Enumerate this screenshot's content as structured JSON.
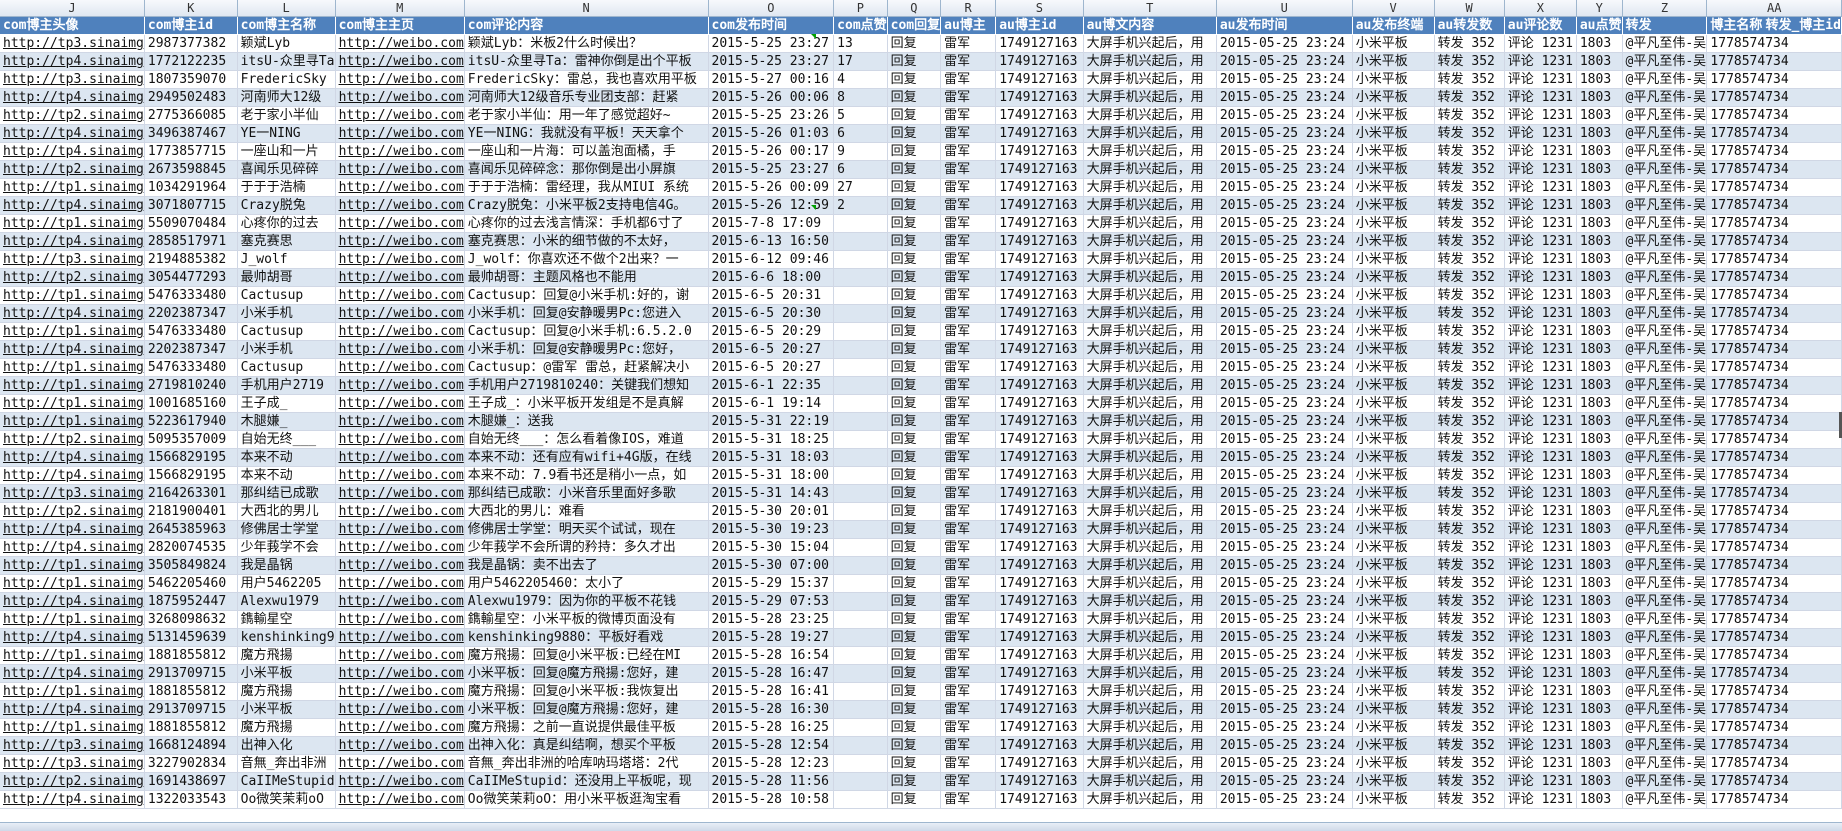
{
  "sheet": {
    "columns": [
      "J",
      "K",
      "L",
      "M",
      "N",
      "O",
      "P",
      "Q",
      "R",
      "S",
      "T",
      "U",
      "V",
      "W",
      "X",
      "Y",
      "Z",
      "AA"
    ],
    "headers": [
      "com博主头像",
      "com博主id",
      "com博主名称",
      "com博主主页",
      "com评论内容",
      "com发布时间",
      "com点赞",
      "com回复",
      "au博主",
      "au博主id",
      "au博文内容",
      "au发布时间",
      "au发布终端",
      "au转发数",
      "au评论数",
      "au点赞",
      "转发",
      "博主名称",
      "转发_博主id"
    ],
    "rows": [
      [
        "http://tp3.sinaimg",
        "2987377382",
        "颖斌Lyb",
        "http://weibo.com",
        "颖斌Lyb：米板2什么时候出？",
        "2015-5-25 23:27",
        "13",
        "回复",
        "雷军",
        "1749127163",
        "大屏手机兴起后，用",
        "2015-05-25 23:24",
        "小米平板",
        "转发 352",
        "评论 1231",
        "1803",
        "@平凡至伟-吴",
        "1778574734"
      ],
      [
        "http://tp4.sinaimg",
        "1772122235",
        "itsU-众里寻Ta",
        "http://weibo.com",
        "itsU-众里寻Ta：雷神你倒是出个平板",
        "2015-5-25 23:27",
        "17",
        "回复",
        "雷军",
        "1749127163",
        "大屏手机兴起后，用",
        "2015-05-25 23:24",
        "小米平板",
        "转发 352",
        "评论 1231",
        "1803",
        "@平凡至伟-吴",
        "1778574734"
      ],
      [
        "http://tp3.sinaimg",
        "1807359070",
        "FredericSky",
        "http://weibo.com",
        "FredericSky：雷总，我也喜欢用平板",
        "2015-5-27 00:16",
        "4",
        "回复",
        "雷军",
        "1749127163",
        "大屏手机兴起后，用",
        "2015-05-25 23:24",
        "小米平板",
        "转发 352",
        "评论 1231",
        "1803",
        "@平凡至伟-吴",
        "1778574734"
      ],
      [
        "http://tp4.sinaimg",
        "2949502483",
        "河南师大12级",
        "http://weibo.com",
        "河南师大12级音乐专业团支部：赶紧",
        "2015-5-26 00:06",
        "8",
        "回复",
        "雷军",
        "1749127163",
        "大屏手机兴起后，用",
        "2015-05-25 23:24",
        "小米平板",
        "转发 352",
        "评论 1231",
        "1803",
        "@平凡至伟-吴",
        "1778574734"
      ],
      [
        "http://tp2.sinaimg",
        "2775366085",
        "老于家小半仙",
        "http://weibo.com",
        "老于家小半仙：用一年了感觉超好~",
        "2015-5-25 23:26",
        "5",
        "回复",
        "雷军",
        "1749127163",
        "大屏手机兴起后，用",
        "2015-05-25 23:24",
        "小米平板",
        "转发 352",
        "评论 1231",
        "1803",
        "@平凡至伟-吴",
        "1778574734"
      ],
      [
        "http://tp4.sinaimg",
        "3496387467",
        "YE一NING",
        "http://weibo.com",
        "YE一NING：我就没有平板！天天拿个",
        "2015-5-26 01:03",
        "6",
        "回复",
        "雷军",
        "1749127163",
        "大屏手机兴起后，用",
        "2015-05-25 23:24",
        "小米平板",
        "转发 352",
        "评论 1231",
        "1803",
        "@平凡至伟-吴",
        "1778574734"
      ],
      [
        "http://tp4.sinaimg",
        "1773857715",
        "一座山和一片",
        "http://weibo.com",
        "一座山和一片海：可以盖泡面橘，手",
        "2015-5-26 00:17",
        "9",
        "回复",
        "雷军",
        "1749127163",
        "大屏手机兴起后，用",
        "2015-05-25 23:24",
        "小米平板",
        "转发 352",
        "评论 1231",
        "1803",
        "@平凡至伟-吴",
        "1778574734"
      ],
      [
        "http://tp2.sinaimg",
        "2673598845",
        "喜闻乐见碎碎",
        "http://weibo.com",
        "喜闻乐见碎碎念：那你倒是出小屏旗",
        "2015-5-25 23:27",
        "6",
        "回复",
        "雷军",
        "1749127163",
        "大屏手机兴起后，用",
        "2015-05-25 23:24",
        "小米平板",
        "转发 352",
        "评论 1231",
        "1803",
        "@平凡至伟-吴",
        "1778574734"
      ],
      [
        "http://tp1.sinaimg",
        "1034291964",
        "于于于浩楠",
        "http://weibo.com",
        "于于于浩楠：雷经理，我从MIUI 系统",
        "2015-5-26 00:09",
        "27",
        "回复",
        "雷军",
        "1749127163",
        "大屏手机兴起后，用",
        "2015-05-25 23:24",
        "小米平板",
        "转发 352",
        "评论 1231",
        "1803",
        "@平凡至伟-吴",
        "1778574734"
      ],
      [
        "http://tp4.sinaimg",
        "3071807715",
        "Crazy脱兔",
        "http://weibo.com",
        "Crazy脱兔：小米平板2支持电信4G。",
        "2015-5-26 12:59",
        "2",
        "回复",
        "雷军",
        "1749127163",
        "大屏手机兴起后，用",
        "2015-05-25 23:24",
        "小米平板",
        "转发 352",
        "评论 1231",
        "1803",
        "@平凡至伟-吴",
        "1778574734"
      ],
      [
        "http://tp1.sinaimg",
        "5509070484",
        "心疼你的过去",
        "http://weibo.com",
        "心疼你的过去浅言情深：手机都6寸了",
        "2015-7-8 17:09",
        "",
        "回复",
        "雷军",
        "1749127163",
        "大屏手机兴起后，用",
        "2015-05-25 23:24",
        "小米平板",
        "转发 352",
        "评论 1231",
        "1803",
        "@平凡至伟-吴",
        "1778574734"
      ],
      [
        "http://tp4.sinaimg",
        "2858517971",
        "塞克赛思",
        "http://weibo.com",
        "塞克赛思：小米的细节做的不太好，",
        "2015-6-13 16:50",
        "",
        "回复",
        "雷军",
        "1749127163",
        "大屏手机兴起后，用",
        "2015-05-25 23:24",
        "小米平板",
        "转发 352",
        "评论 1231",
        "1803",
        "@平凡至伟-吴",
        "1778574734"
      ],
      [
        "http://tp3.sinaimg",
        "2194885382",
        "J_wolf",
        "http://weibo.com",
        "J_wolf：你喜欢还不做个2出来？一",
        "2015-6-12 09:46",
        "",
        "回复",
        "雷军",
        "1749127163",
        "大屏手机兴起后，用",
        "2015-05-25 23:24",
        "小米平板",
        "转发 352",
        "评论 1231",
        "1803",
        "@平凡至伟-吴",
        "1778574734"
      ],
      [
        "http://tp2.sinaimg",
        "3054477293",
        "最帅胡哥",
        "http://weibo.com",
        "最帅胡哥：主题风格也不能用",
        "2015-6-6 18:00",
        "",
        "回复",
        "雷军",
        "1749127163",
        "大屏手机兴起后，用",
        "2015-05-25 23:24",
        "小米平板",
        "转发 352",
        "评论 1231",
        "1803",
        "@平凡至伟-吴",
        "1778574734"
      ],
      [
        "http://tp1.sinaimg",
        "5476333480",
        "Cactusup",
        "http://weibo.com",
        "Cactusup：回复@小米手机:好的，谢",
        "2015-6-5 20:31",
        "",
        "回复",
        "雷军",
        "1749127163",
        "大屏手机兴起后，用",
        "2015-05-25 23:24",
        "小米平板",
        "转发 352",
        "评论 1231",
        "1803",
        "@平凡至伟-吴",
        "1778574734"
      ],
      [
        "http://tp4.sinaimg",
        "2202387347",
        "小米手机",
        "http://weibo.com",
        "小米手机：回复@安静暖男Pc:您进入",
        "2015-6-5 20:30",
        "",
        "回复",
        "雷军",
        "1749127163",
        "大屏手机兴起后，用",
        "2015-05-25 23:24",
        "小米平板",
        "转发 352",
        "评论 1231",
        "1803",
        "@平凡至伟-吴",
        "1778574734"
      ],
      [
        "http://tp1.sinaimg",
        "5476333480",
        "Cactusup",
        "http://weibo.com",
        "Cactusup：回复@小米手机:6.5.2.0",
        "2015-6-5 20:29",
        "",
        "回复",
        "雷军",
        "1749127163",
        "大屏手机兴起后，用",
        "2015-05-25 23:24",
        "小米平板",
        "转发 352",
        "评论 1231",
        "1803",
        "@平凡至伟-吴",
        "1778574734"
      ],
      [
        "http://tp4.sinaimg",
        "2202387347",
        "小米手机",
        "http://weibo.com",
        "小米手机：回复@安静暖男Pc:您好，",
        "2015-6-5 20:27",
        "",
        "回复",
        "雷军",
        "1749127163",
        "大屏手机兴起后，用",
        "2015-05-25 23:24",
        "小米平板",
        "转发 352",
        "评论 1231",
        "1803",
        "@平凡至伟-吴",
        "1778574734"
      ],
      [
        "http://tp1.sinaimg",
        "5476333480",
        "Cactusup",
        "http://weibo.com",
        "Cactusup：@雷军 雷总，赶紧解决小",
        "2015-6-5 20:27",
        "",
        "回复",
        "雷军",
        "1749127163",
        "大屏手机兴起后，用",
        "2015-05-25 23:24",
        "小米平板",
        "转发 352",
        "评论 1231",
        "1803",
        "@平凡至伟-吴",
        "1778574734"
      ],
      [
        "http://tp1.sinaimg",
        "2719810240",
        "手机用户2719",
        "http://weibo.com",
        "手机用户2719810240：关键我们想知",
        "2015-6-1 22:35",
        "",
        "回复",
        "雷军",
        "1749127163",
        "大屏手机兴起后，用",
        "2015-05-25 23:24",
        "小米平板",
        "转发 352",
        "评论 1231",
        "1803",
        "@平凡至伟-吴",
        "1778574734"
      ],
      [
        "http://tp1.sinaimg",
        "1001685160",
        "王子成_",
        "http://weibo.com",
        "王子成_：小米平板开发组是不是真解",
        "2015-6-1 19:14",
        "",
        "回复",
        "雷军",
        "1749127163",
        "大屏手机兴起后，用",
        "2015-05-25 23:24",
        "小米平板",
        "转发 352",
        "评论 1231",
        "1803",
        "@平凡至伟-吴",
        "1778574734"
      ],
      [
        "http://tp1.sinaimg",
        "5223617940",
        "木腿嫌_",
        "http://weibo.com",
        "木腿嫌_：送我",
        "2015-5-31 22:19",
        "",
        "回复",
        "雷军",
        "1749127163",
        "大屏手机兴起后，用",
        "2015-05-25 23:24",
        "小米平板",
        "转发 352",
        "评论 1231",
        "1803",
        "@平凡至伟-吴",
        "1778574734"
      ],
      [
        "http://tp2.sinaimg",
        "5095357009",
        "自始无终___",
        "http://weibo.com",
        "自始无终___：怎么看着像IOS，难道",
        "2015-5-31 18:25",
        "",
        "回复",
        "雷军",
        "1749127163",
        "大屏手机兴起后，用",
        "2015-05-25 23:24",
        "小米平板",
        "转发 352",
        "评论 1231",
        "1803",
        "@平凡至伟-吴",
        "1778574734"
      ],
      [
        "http://tp4.sinaimg",
        "1566829195",
        "本来不动",
        "http://weibo.com",
        "本来不动：还有应有wifi+4G版，在线",
        "2015-5-31 18:03",
        "",
        "回复",
        "雷军",
        "1749127163",
        "大屏手机兴起后，用",
        "2015-05-25 23:24",
        "小米平板",
        "转发 352",
        "评论 1231",
        "1803",
        "@平凡至伟-吴",
        "1778574734"
      ],
      [
        "http://tp4.sinaimg",
        "1566829195",
        "本来不动",
        "http://weibo.com",
        "本来不动：7.9看书还是稍小一点，如",
        "2015-5-31 18:00",
        "",
        "回复",
        "雷军",
        "1749127163",
        "大屏手机兴起后，用",
        "2015-05-25 23:24",
        "小米平板",
        "转发 352",
        "评论 1231",
        "1803",
        "@平凡至伟-吴",
        "1778574734"
      ],
      [
        "http://tp3.sinaimg",
        "2164263301",
        "那纠结已成歌",
        "http://weibo.com",
        "那纠结已成歌：小米音乐里面好多歌",
        "2015-5-31 14:43",
        "",
        "回复",
        "雷军",
        "1749127163",
        "大屏手机兴起后，用",
        "2015-05-25 23:24",
        "小米平板",
        "转发 352",
        "评论 1231",
        "1803",
        "@平凡至伟-吴",
        "1778574734"
      ],
      [
        "http://tp2.sinaimg",
        "2181900401",
        "大西北的男儿",
        "http://weibo.com",
        "大西北的男儿：难看",
        "2015-5-30 20:01",
        "",
        "回复",
        "雷军",
        "1749127163",
        "大屏手机兴起后，用",
        "2015-05-25 23:24",
        "小米平板",
        "转发 352",
        "评论 1231",
        "1803",
        "@平凡至伟-吴",
        "1778574734"
      ],
      [
        "http://tp4.sinaimg",
        "2645385963",
        "修佛居士学堂",
        "http://weibo.com",
        "修佛居士学堂：明天买个试试，现在",
        "2015-5-30 19:23",
        "",
        "回复",
        "雷军",
        "1749127163",
        "大屏手机兴起后，用",
        "2015-05-25 23:24",
        "小米平板",
        "转发 352",
        "评论 1231",
        "1803",
        "@平凡至伟-吴",
        "1778574734"
      ],
      [
        "http://tp4.sinaimg",
        "2820074535",
        "少年莪学不会",
        "http://weibo.com",
        "少年莪学不会所谓的矜持：多久才出",
        "2015-5-30 15:04",
        "",
        "回复",
        "雷军",
        "1749127163",
        "大屏手机兴起后，用",
        "2015-05-25 23:24",
        "小米平板",
        "转发 352",
        "评论 1231",
        "1803",
        "@平凡至伟-吴",
        "1778574734"
      ],
      [
        "http://tp1.sinaimg",
        "3505849824",
        "我是晶锅",
        "http://weibo.com",
        "我是晶锅：卖不出去了",
        "2015-5-30 07:00",
        "",
        "回复",
        "雷军",
        "1749127163",
        "大屏手机兴起后，用",
        "2015-05-25 23:24",
        "小米平板",
        "转发 352",
        "评论 1231",
        "1803",
        "@平凡至伟-吴",
        "1778574734"
      ],
      [
        "http://tp1.sinaimg",
        "5462205460",
        "用户5462205",
        "http://weibo.com",
        "用户5462205460：太小了",
        "2015-5-29 15:37",
        "",
        "回复",
        "雷军",
        "1749127163",
        "大屏手机兴起后，用",
        "2015-05-25 23:24",
        "小米平板",
        "转发 352",
        "评论 1231",
        "1803",
        "@平凡至伟-吴",
        "1778574734"
      ],
      [
        "http://tp4.sinaimg",
        "1875952447",
        "Alexwu1979",
        "http://weibo.com",
        "Alexwu1979：因为你的平板不花钱",
        "2015-5-29 07:53",
        "",
        "回复",
        "雷军",
        "1749127163",
        "大屏手机兴起后，用",
        "2015-05-25 23:24",
        "小米平板",
        "转发 352",
        "评论 1231",
        "1803",
        "@平凡至伟-吴",
        "1778574734"
      ],
      [
        "http://tp1.sinaimg",
        "3268098632",
        "鐫輸星空",
        "http://weibo.com",
        "鐫輸星空：小米平板的微博页面没有",
        "2015-5-28 23:25",
        "",
        "回复",
        "雷军",
        "1749127163",
        "大屏手机兴起后，用",
        "2015-05-25 23:24",
        "小米平板",
        "转发 352",
        "评论 1231",
        "1803",
        "@平凡至伟-吴",
        "1778574734"
      ],
      [
        "http://tp4.sinaimg",
        "5131459639",
        "kenshinking9",
        "http://weibo.com",
        "kenshinking9880：平板好看戏",
        "2015-5-28 19:27",
        "",
        "回复",
        "雷军",
        "1749127163",
        "大屏手机兴起后，用",
        "2015-05-25 23:24",
        "小米平板",
        "转发 352",
        "评论 1231",
        "1803",
        "@平凡至伟-吴",
        "1778574734"
      ],
      [
        "http://tp1.sinaimg",
        "1881855812",
        "魔方飛揚",
        "http://weibo.com",
        "魔方飛揚：回复@小米平板:已经在MI",
        "2015-5-28 16:54",
        "",
        "回复",
        "雷军",
        "1749127163",
        "大屏手机兴起后，用",
        "2015-05-25 23:24",
        "小米平板",
        "转发 352",
        "评论 1231",
        "1803",
        "@平凡至伟-吴",
        "1778574734"
      ],
      [
        "http://tp4.sinaimg",
        "2913709715",
        "小米平板",
        "http://weibo.com",
        "小米平板：回复@魔方飛揚:您好，建",
        "2015-5-28 16:47",
        "",
        "回复",
        "雷军",
        "1749127163",
        "大屏手机兴起后，用",
        "2015-05-25 23:24",
        "小米平板",
        "转发 352",
        "评论 1231",
        "1803",
        "@平凡至伟-吴",
        "1778574734"
      ],
      [
        "http://tp1.sinaimg",
        "1881855812",
        "魔方飛揚",
        "http://weibo.com",
        "魔方飛揚：回复@小米平板:我恢复出",
        "2015-5-28 16:41",
        "",
        "回复",
        "雷军",
        "1749127163",
        "大屏手机兴起后，用",
        "2015-05-25 23:24",
        "小米平板",
        "转发 352",
        "评论 1231",
        "1803",
        "@平凡至伟-吴",
        "1778574734"
      ],
      [
        "http://tp4.sinaimg",
        "2913709715",
        "小米平板",
        "http://weibo.com",
        "小米平板：回复@魔方飛揚:您好，建",
        "2015-5-28 16:30",
        "",
        "回复",
        "雷军",
        "1749127163",
        "大屏手机兴起后，用",
        "2015-05-25 23:24",
        "小米平板",
        "转发 352",
        "评论 1231",
        "1803",
        "@平凡至伟-吴",
        "1778574734"
      ],
      [
        "http://tp1.sinaimg",
        "1881855812",
        "魔方飛揚",
        "http://weibo.com",
        "魔方飛揚：之前一直说提供最佳平板",
        "2015-5-28 16:25",
        "",
        "回复",
        "雷军",
        "1749127163",
        "大屏手机兴起后，用",
        "2015-05-25 23:24",
        "小米平板",
        "转发 352",
        "评论 1231",
        "1803",
        "@平凡至伟-吴",
        "1778574734"
      ],
      [
        "http://tp3.sinaimg",
        "1668124894",
        "出神入化",
        "http://weibo.com",
        "出神入化：真是纠结啊，想买个平板",
        "2015-5-28 12:54",
        "",
        "回复",
        "雷军",
        "1749127163",
        "大屏手机兴起后，用",
        "2015-05-25 23:24",
        "小米平板",
        "转发 352",
        "评论 1231",
        "1803",
        "@平凡至伟-吴",
        "1778574734"
      ],
      [
        "http://tp3.sinaimg",
        "3227902834",
        "音無_奔出非洲",
        "http://weibo.com",
        "音無_奔出非洲的哈库呐玛塔塔：2代",
        "2015-5-28 12:23",
        "",
        "回复",
        "雷军",
        "1749127163",
        "大屏手机兴起后，用",
        "2015-05-25 23:24",
        "小米平板",
        "转发 352",
        "评论 1231",
        "1803",
        "@平凡至伟-吴",
        "1778574734"
      ],
      [
        "http://tp2.sinaimg",
        "1691438697",
        "CaIIMeStupid",
        "http://weibo.com",
        "CaIIMeStupid：还没用上平板呢，现",
        "2015-5-28 11:56",
        "",
        "回复",
        "雷军",
        "1749127163",
        "大屏手机兴起后，用",
        "2015-05-25 23:24",
        "小米平板",
        "转发 352",
        "评论 1231",
        "1803",
        "@平凡至伟-吴",
        "1778574734"
      ],
      [
        "http://tp4.sinaimg",
        "1322033543",
        "Oo微笑茉莉oO",
        "http://weibo.com",
        "Oo微笑茉莉oO：用小米平板逛淘宝看",
        "2015-5-28 10:58",
        "",
        "回复",
        "雷军",
        "1749127163",
        "大屏手机兴起后，用",
        "2015-05-25 23:24",
        "小米平板",
        "转发 352",
        "评论 1231",
        "1803",
        "@平凡至伟-吴",
        "1778574734"
      ]
    ]
  }
}
